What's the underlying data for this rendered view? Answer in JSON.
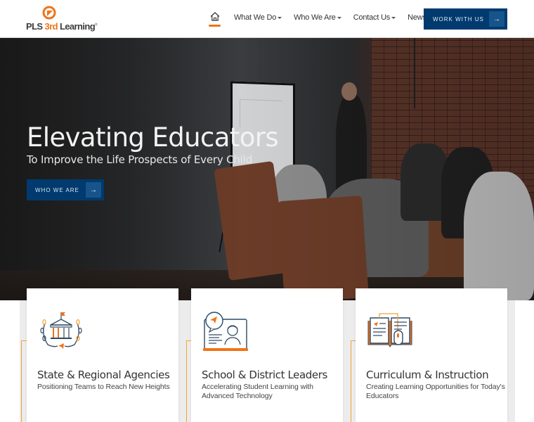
{
  "header": {
    "logo": {
      "brand_prefix": "PLS ",
      "brand_accent": "3rd",
      "brand_suffix": " Learning",
      "trademark": "®",
      "mark_icon": "pls-logo-mark-icon"
    },
    "nav": [
      {
        "label": "Home",
        "icon": "home-icon",
        "active": true
      },
      {
        "label": "What We Do",
        "has_dropdown": true
      },
      {
        "label": "Who We Are",
        "has_dropdown": true
      },
      {
        "label": "Contact Us",
        "has_dropdown": true
      },
      {
        "label": "News",
        "has_dropdown": false
      }
    ],
    "cta": {
      "label": "WORK WITH US",
      "arrow": "→"
    }
  },
  "hero": {
    "title": "Elevating Educators",
    "subtitle": "To Improve the Life Prospects of Every Child",
    "button": {
      "label": "WHO WE ARE",
      "arrow": "→"
    }
  },
  "cards": [
    {
      "icon": "capitol-laurel-icon",
      "title": "State & Regional Agencies",
      "description": "Positioning Teams to Reach New Heights"
    },
    {
      "icon": "laptop-teacher-icon",
      "title": "School & District Leaders",
      "description": "Accelerating Student Learning with Advanced Technology"
    },
    {
      "icon": "book-mouse-icon",
      "title": "Curriculum & Instruction",
      "description": "Creating Learning Opportunities for Today's Educators"
    }
  ],
  "colors": {
    "brand_orange": "#f07318",
    "brand_navy": "#003a6e",
    "button_arrow_bg": "#17548c",
    "accent_line": "#f3a233",
    "text_dark": "#333333"
  }
}
